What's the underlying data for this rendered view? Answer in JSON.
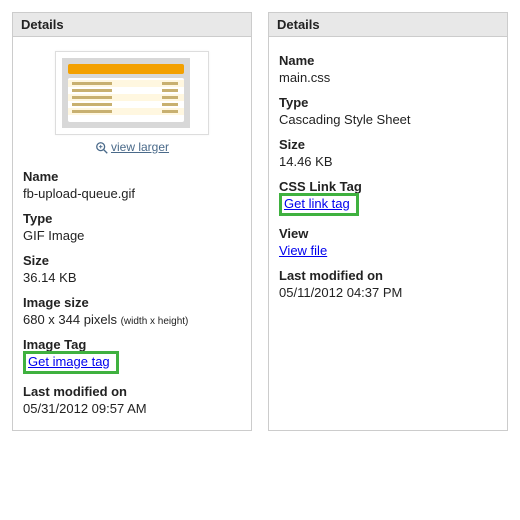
{
  "left": {
    "header": "Details",
    "view_larger": "view larger",
    "fields": {
      "name_label": "Name",
      "name_value": "fb-upload-queue.gif",
      "type_label": "Type",
      "type_value": "GIF Image",
      "size_label": "Size",
      "size_value": "36.14 KB",
      "imgsize_label": "Image size",
      "imgsize_value": "680 x 344 pixels",
      "imgsize_note": "(width x height)",
      "imgtag_label": "Image Tag",
      "imgtag_link": "Get image tag",
      "modified_label": "Last modified on",
      "modified_value": "05/31/2012 09:57 AM"
    }
  },
  "right": {
    "header": "Details",
    "fields": {
      "name_label": "Name",
      "name_value": "main.css",
      "type_label": "Type",
      "type_value": "Cascading Style Sheet",
      "size_label": "Size",
      "size_value": "14.46 KB",
      "csslink_label": "CSS Link Tag",
      "csslink_link": "Get link tag",
      "view_label": "View",
      "view_link": "View file",
      "modified_label": "Last modified on",
      "modified_value": "05/11/2012 04:37 PM"
    }
  }
}
